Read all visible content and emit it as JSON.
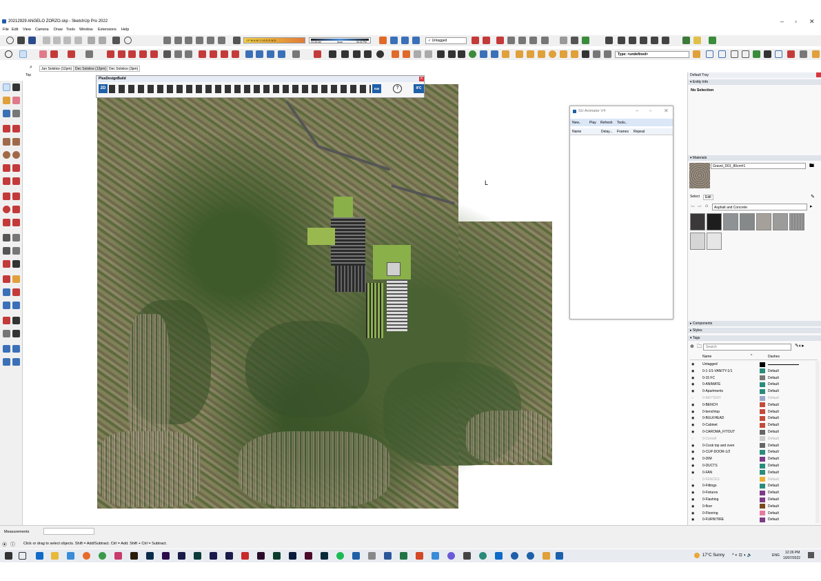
{
  "window": {
    "title": "20212929 ANGELO ZORZO.skp - SketchUp Pro 2022",
    "min": "–",
    "max": "▫",
    "close": "✕"
  },
  "menu": [
    "File",
    "Edit",
    "View",
    "Camera",
    "Draw",
    "Tools",
    "Window",
    "Extensions",
    "Help"
  ],
  "shadow": {
    "months": "J F M A M J J A S O N D",
    "time_start": "04:45 AM",
    "noon": "Noon",
    "time_end": "05:40 PM"
  },
  "tag_select": "Untagged",
  "type_field": "Type: <undefined>",
  "scenes": [
    "Jun Solstice (12pm)",
    "Dec Solstice (12pm)",
    "Dec Solstice (3pm)"
  ],
  "view_label": "Top",
  "plugin_toolbar": {
    "title": "PlusDesignBuild",
    "labels": [
      "2D",
      "BIM",
      "IFC"
    ]
  },
  "animator": {
    "title": "SU Animator V4",
    "menu": [
      "New..",
      "Play",
      "Refresh",
      "Tools.."
    ],
    "columns": [
      "Name",
      "Delay...",
      "Frames",
      "Repeat"
    ]
  },
  "tray": {
    "title": "Default Tray",
    "entity_info": "Entity Info",
    "no_selection": "No Selection",
    "materials": "Materials",
    "material_name": "Gravel_D01_80cm#1",
    "tabs": [
      "Select",
      "Edit"
    ],
    "library": "Asphalt and Concrete",
    "components": "Components",
    "styles": "Styles",
    "tags": "Tags",
    "search_placeholder": "Search",
    "col_name": "Name",
    "col_dashes": "Dashes",
    "tag_rows": [
      {
        "name": "Untagged",
        "color": "#000000",
        "dash": "",
        "visible": true
      },
      {
        "name": "0-1-1/1-VANITY-1/1",
        "color": "#2a8c7c",
        "dash": "Default",
        "visible": true
      },
      {
        "name": "0-15 FC",
        "color": "#777777",
        "dash": "Default",
        "visible": true
      },
      {
        "name": "0-ANIMATE",
        "color": "#2a8c7c",
        "dash": "Default",
        "visible": true
      },
      {
        "name": "0-Apartments",
        "color": "#2a8c7c",
        "dash": "Default",
        "visible": true
      },
      {
        "name": "0-BATTERY",
        "color": "#9aa7c9",
        "dash": "Default",
        "visible": false
      },
      {
        "name": "0-BENCH",
        "color": "#c44a3a",
        "dash": "Default",
        "visible": true
      },
      {
        "name": "0-benchtop",
        "color": "#c44a3a",
        "dash": "Default",
        "visible": true
      },
      {
        "name": "0-BULKHEAD",
        "color": "#c44a3a",
        "dash": "Default",
        "visible": true
      },
      {
        "name": "0-Cabinet",
        "color": "#c44a3a",
        "dash": "Default",
        "visible": true
      },
      {
        "name": "0-CAROMA_FITOUT",
        "color": "#666666",
        "dash": "Default",
        "visible": true
      },
      {
        "name": "0-Cornell",
        "color": "#cccccc",
        "dash": "Default",
        "visible": false
      },
      {
        "name": "0-Cook top and oven",
        "color": "#666666",
        "dash": "Default",
        "visible": true
      },
      {
        "name": "0-CUP-DOOR-1/2",
        "color": "#2a8c7c",
        "dash": "Default",
        "visible": true
      },
      {
        "name": "0-DIM",
        "color": "#7e3b86",
        "dash": "Default",
        "visible": true
      },
      {
        "name": "0-DUCTS",
        "color": "#2a8c7c",
        "dash": "Default",
        "visible": true
      },
      {
        "name": "0-FAN",
        "color": "#2a8c7c",
        "dash": "Default",
        "visible": true
      },
      {
        "name": "0-FENCES",
        "color": "#e8b23a",
        "dash": "Default",
        "visible": false
      },
      {
        "name": "0-Fittings",
        "color": "#2a8c7c",
        "dash": "Default",
        "visible": true
      },
      {
        "name": "0-Fixtures",
        "color": "#7e3b86",
        "dash": "Default",
        "visible": true
      },
      {
        "name": "0-Flashing",
        "color": "#7e3b86",
        "dash": "Default",
        "visible": true
      },
      {
        "name": "0-floor",
        "color": "#7a4a1e",
        "dash": "Default",
        "visible": true
      },
      {
        "name": "0-Flooring",
        "color": "#e57aa0",
        "dash": "Default",
        "visible": true
      },
      {
        "name": "0-FURNITIRE",
        "color": "#7e3b86",
        "dash": "Default",
        "visible": true
      }
    ]
  },
  "status": {
    "measurements": "Measurements",
    "hint": "Click or drag to select objects. Shift = Add/Subtract. Ctrl = Add. Shift + Ctrl = Subtract."
  },
  "taskbar": {
    "weather": "17°C Sunny",
    "lang": "ENG",
    "time": "12:26 PM",
    "date": "10/07/2022"
  }
}
